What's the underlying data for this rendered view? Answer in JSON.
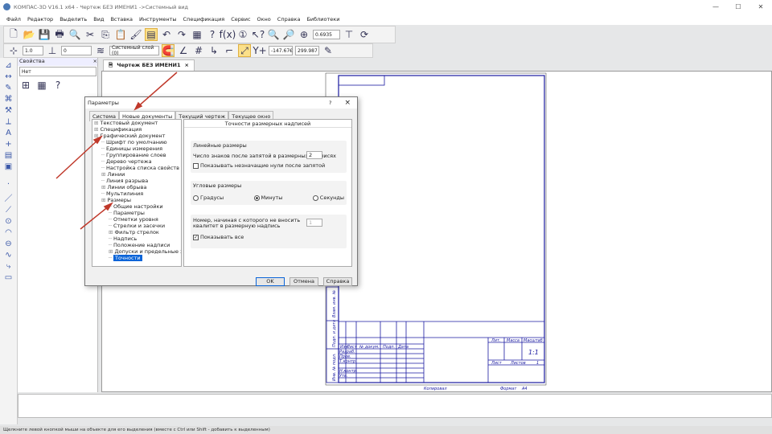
{
  "title": "КОМПАС-3D V16.1 x64 - Чертеж БЕЗ ИМЕНИ1 ->Системный вид",
  "menu": [
    "Файл",
    "Редактор",
    "Выделить",
    "Вид",
    "Вставка",
    "Инструменты",
    "Спецификация",
    "Сервис",
    "Окно",
    "Справка",
    "Библиотеки"
  ],
  "toolbar": {
    "zoom_value": "0.6935",
    "line_style": "1.0",
    "layer_field": "0",
    "layer": "Системный слой (0)",
    "coord_x": "-147.67€",
    "coord_y": "299.987"
  },
  "props": {
    "title": "Свойства",
    "value": "Нет"
  },
  "doc_tab": "Чертеж БЕЗ ИМЕНИ1",
  "dialog": {
    "title": "Параметры",
    "help": "?",
    "close": "×",
    "tabs": [
      "Система",
      "Новые документы",
      "Текущий чертеж",
      "Текущее окно"
    ],
    "tree": [
      {
        "t": "Текстовый документ",
        "lvl": 0,
        "exp": "+"
      },
      {
        "t": "Спецификация",
        "lvl": 0,
        "exp": "+"
      },
      {
        "t": "Графический документ",
        "lvl": 0,
        "exp": "−"
      },
      {
        "t": "Шрифт по умолчанию",
        "lvl": 1
      },
      {
        "t": "Единицы измерения",
        "lvl": 1
      },
      {
        "t": "Группирование слоев",
        "lvl": 1
      },
      {
        "t": "Дерево чертежа",
        "lvl": 1
      },
      {
        "t": "Настройка списка свойств",
        "lvl": 1
      },
      {
        "t": "Линии",
        "lvl": 1,
        "exp": "+"
      },
      {
        "t": "Линия разрыва",
        "lvl": 1
      },
      {
        "t": "Линии обрыва",
        "lvl": 1,
        "exp": "+"
      },
      {
        "t": "Мультилиния",
        "lvl": 1
      },
      {
        "t": "Размеры",
        "lvl": 1,
        "exp": "−"
      },
      {
        "t": "Общие настройки",
        "lvl": 2
      },
      {
        "t": "Параметры",
        "lvl": 2
      },
      {
        "t": "Отметки уровня",
        "lvl": 2
      },
      {
        "t": "Стрелки и засечки",
        "lvl": 2
      },
      {
        "t": "Фильтр стрелок",
        "lvl": 2,
        "exp": "+"
      },
      {
        "t": "Надпись",
        "lvl": 2
      },
      {
        "t": "Положение надписи",
        "lvl": 2
      },
      {
        "t": "Допуски и предельные знач",
        "lvl": 2,
        "exp": "+"
      },
      {
        "t": "Точности",
        "lvl": 2,
        "sel": true
      }
    ],
    "panel_title": "Точности размерных надписей",
    "linear_group": "Линейные размеры",
    "decimals_label": "Число знаков после запятой в размерных надписях",
    "decimals_value": "2",
    "show_zeros_label": "Показывать незначащие нули после запятой",
    "show_zeros": false,
    "angular_group": "Угловые размеры",
    "angular_options": [
      "Градусы",
      "Минуты",
      "Секунды"
    ],
    "angular_selected": "Минуты",
    "qualitet_label": "Номер, начиная с которого не вносить квалитет в размерную надпись",
    "qualitet_value": "1",
    "show_all_label": "Показывать все",
    "show_all": true,
    "ok": "OK",
    "cancel": "Отмена",
    "help_btn": "Справка"
  },
  "stamp": {
    "headers": [
      "Изм",
      "Лист",
      "№ докум.",
      "Подп.",
      "Дата"
    ],
    "rows": [
      "Разраб.",
      "Пров.",
      "Т.контр.",
      "Н.контр.",
      "Утв."
    ],
    "lit": "Лит.",
    "mass": "Масса",
    "scale": "Масштаб",
    "scale_value": "1:1",
    "sheet": "Лист",
    "sheets": "Листов",
    "sheets_value": "1",
    "copied": "Копировал",
    "format": "Формат",
    "format_value": "A4",
    "side": [
      "Инв. № подл.",
      "Подп. и дата",
      "Взам. инв. №",
      "Инв. № дубл.",
      "Подп. и дата"
    ]
  },
  "status": "Щелкните левой кнопкой мыши на объекте для его выделения (вместе с Ctrl или Shift - добавить к выделенным)",
  "colors": {
    "frame": "#1a1aa0",
    "arrow": "#c0392b",
    "selection": "#0a64d8",
    "highlight": "#fbe08a"
  }
}
